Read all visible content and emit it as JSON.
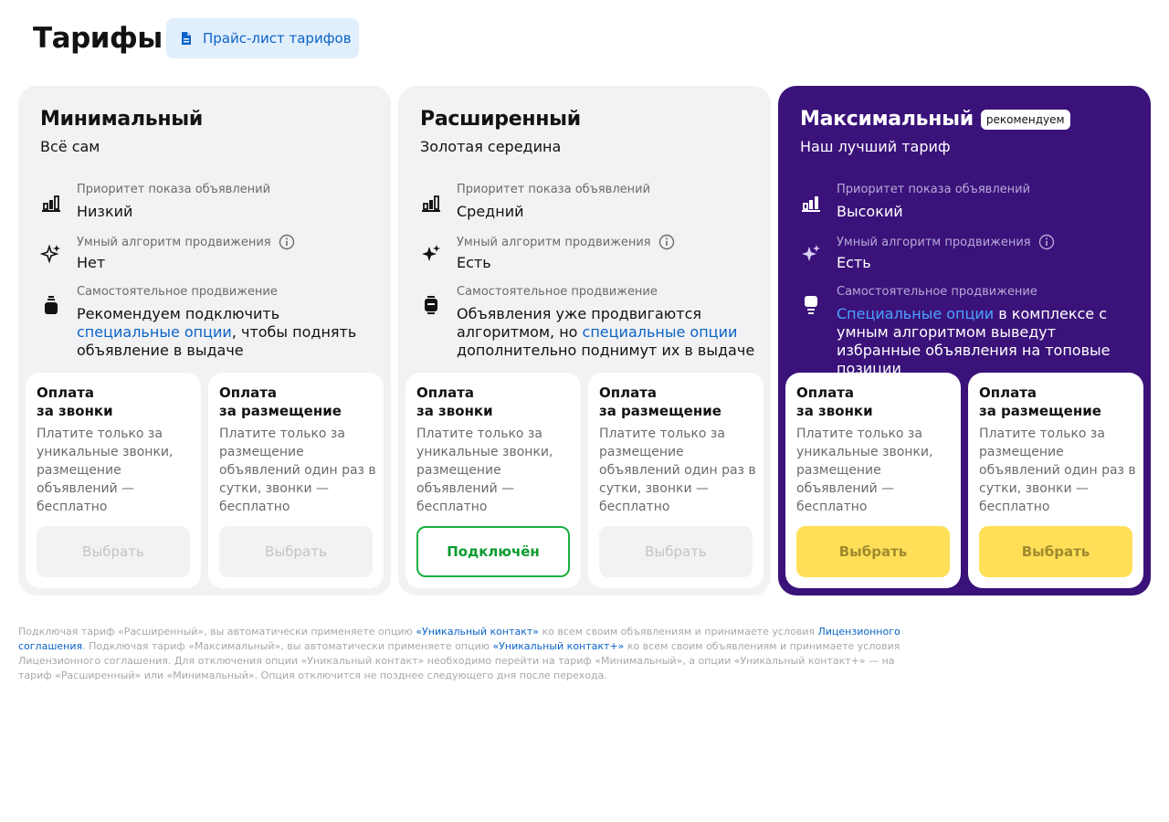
{
  "page": {
    "title": "Тарифы",
    "pricelist_label": "Прайс-лист тарифов"
  },
  "feature_labels": {
    "priority": "Приоритет показа объявлений",
    "algorithm": "Умный алгоритм продвижения",
    "self_promo": "Самостоятельное продвижение"
  },
  "pay_options": {
    "calls_title_line1": "Оплата",
    "calls_title_line2": "за звонки",
    "calls_desc": "Платите только за уникальные звонки, размещение объявлений — бесплатно",
    "placement_title_line1": "Оплата",
    "placement_title_line2": "за размещение",
    "placement_desc": "Платите только за размещение объявлений один раз в сутки, звонки — бесплатно"
  },
  "tariffs": [
    {
      "name": "Минимальный",
      "subtitle": "Всё сам",
      "priority": "Низкий",
      "algorithm": "Нет",
      "promo_pre": "Рекомендуем подключить ",
      "promo_link": "специальные опции",
      "promo_post": ", чтобы поднять объявление в выдаче",
      "calls_button": "Выбрать",
      "placement_button": "Выбрать"
    },
    {
      "name": "Расширенный",
      "subtitle": "Золотая середина",
      "priority": "Средний",
      "algorithm": "Есть",
      "promo_pre": "Объявления уже продвигаются алгоритмом, но ",
      "promo_link": "специальные опции",
      "promo_post": " дополнительно поднимут их в выдаче",
      "calls_button": "Подключён",
      "placement_button": "Выбрать"
    },
    {
      "name": "Максимальный",
      "badge": "рекомендуем",
      "subtitle": "Наш лучший тариф",
      "priority": "Высокий",
      "algorithm": "Есть",
      "promo_pre": "",
      "promo_link": "Специальные опции",
      "promo_post": " в комплексе с умным алгоритмом выведут избранные объявления на топовые позиции",
      "calls_button": "Выбрать",
      "placement_button": "Выбрать"
    }
  ],
  "footnote": {
    "part1": "Подключая тариф «Расширенный», вы автоматически применяете опцию ",
    "link1": "«Уникальный контакт»",
    "part2": " ко всем своим объявлениям и принимаете условия ",
    "link2": "Лицензионного соглашения",
    "part3": ". Подключая тариф «Максимальный», вы автоматически применяете опцию ",
    "link3": "«Уникальный контакт+»",
    "part4": " ко всем своим объявлениям и принимаете условия Лицензионного соглашения. Для отключения опции «Уникальный контакт» необходимо перейти на тариф «Минимальный», а опции «Уникальный контакт+» — на тариф «Расширенный» или «Минимальный». Опция отключится не позднее следующего дня после перехода."
  },
  "colors": {
    "accent_link": "#0a64c8",
    "purple_card": "#3a127a",
    "connected_green": "#19b03e",
    "select_yellow": "#ffdf58"
  },
  "icons": {
    "pricelist": "document-icon",
    "priority": "bar-chart-icon",
    "algorithm": "sparkles-icon",
    "promo": "booster-icon",
    "info": "info-icon"
  }
}
